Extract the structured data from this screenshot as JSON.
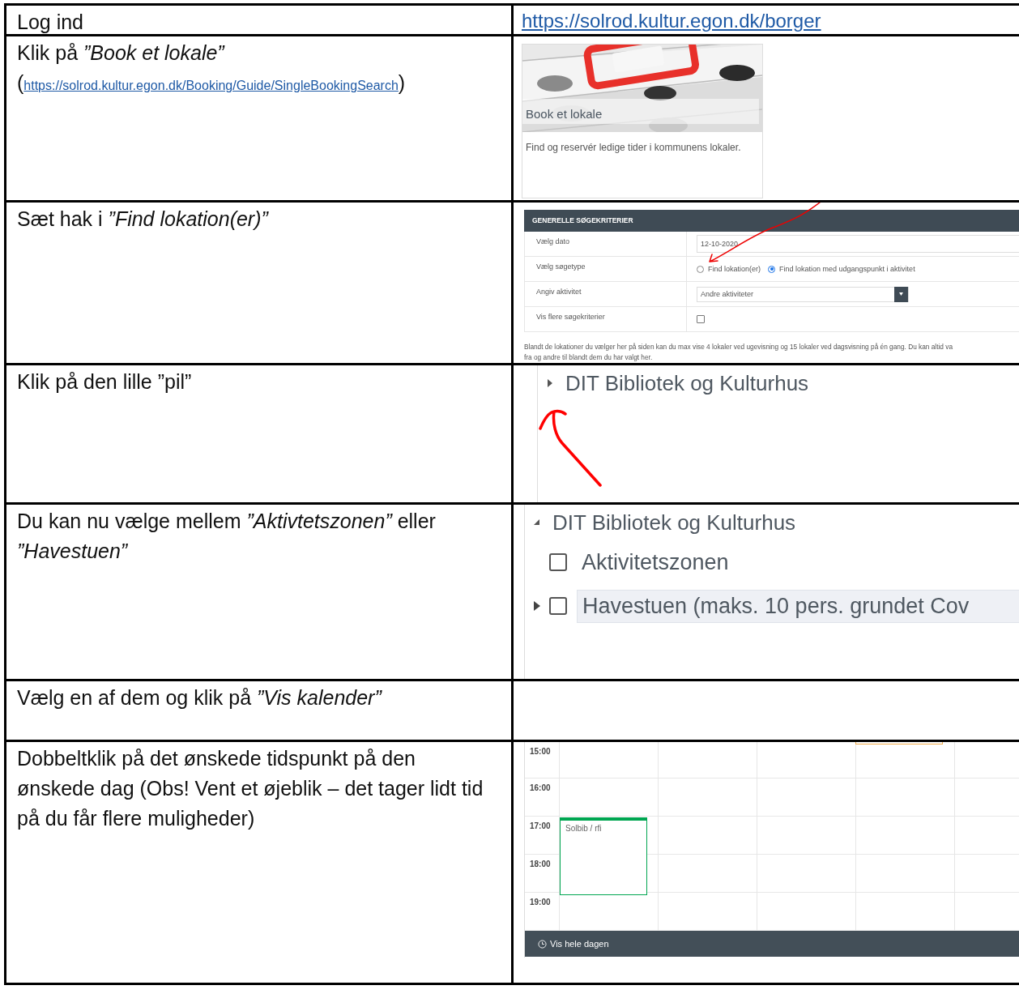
{
  "steps": [
    {
      "instruction": "Log ind",
      "illustration": {
        "kind": "link",
        "url": "https://solrod.kultur.egon.dk/borger"
      }
    },
    {
      "instruction": "Klik på *”Book et lokale”*",
      "link_prefix": "(",
      "link": "https://solrod.kultur.egon.dk/Booking/Guide/SingleBookingSearch",
      "link_suffix": ")",
      "illustration": {
        "kind": "card",
        "title": "Book et lokale",
        "description": "Find og reservér ledige tider i kommunens lokaler."
      }
    },
    {
      "instruction": "Sæt hak i *”Find lokation(er)”*",
      "illustration": {
        "kind": "form",
        "header": "GENERELLE SØGEKRITERIER",
        "fields": [
          {
            "kind": "date",
            "label": "Vælg dato",
            "value": "12-10-2020"
          },
          {
            "kind": "radio",
            "label": "Vælg søgetype",
            "options": [
              {
                "label": "Find lokation(er)",
                "selected": false
              },
              {
                "label": "Find lokation med udgangspunkt i aktivitet",
                "selected": true
              }
            ]
          },
          {
            "kind": "select",
            "label": "Angiv aktivitet",
            "value": "Andre aktiviteter"
          },
          {
            "kind": "checkbox",
            "label": "Vis flere søgekriterier",
            "checked": false
          }
        ],
        "note": [
          "Blandt de lokationer du vælger her på siden kan du max vise 4 lokaler ved ugevisning og 15 lokaler ved dagsvisning på én gang. Du kan altid va",
          "fra og andre til blandt dem du har valgt her."
        ]
      }
    },
    {
      "instruction": "Klik på den lille ”pil”",
      "illustration": {
        "kind": "tree",
        "arrow": true,
        "nodes": [
          {
            "label": "DIT Bibliotek og Kulturhus",
            "expanded": false
          }
        ]
      }
    },
    {
      "instruction": "Du kan nu vælge mellem *”Aktivtetszonen”* eller *”Havestuen”*",
      "illustration": {
        "kind": "tree",
        "arrow": false,
        "nodes": [
          {
            "label": "DIT Bibliotek og Kulturhus",
            "expanded": true,
            "children": [
              {
                "label": "Aktivitetszonen",
                "checked": false,
                "highlighted": false,
                "expandable": false
              },
              {
                "label": "Havestuen (maks. 10 pers. grundet Cov",
                "checked": false,
                "highlighted": true,
                "expandable": true
              }
            ]
          }
        ]
      }
    },
    {
      "instruction": "Vælg en af dem og klik på *”Vis kalender”*"
    },
    {
      "instruction": "Dobbeltklik på det ønskede tidspunkt på den ønskede dag (Obs! Vent et øjeblik – det tager lidt tid på du får flere muligheder)",
      "illustration": {
        "kind": "calendar",
        "times": [
          "15:00",
          "16:00",
          "17:00",
          "18:00",
          "19:00"
        ],
        "events": [
          {
            "kind": "tail",
            "color": "#f0ad4e"
          },
          {
            "kind": "block",
            "color": "#00a651",
            "label": "Solbib / rfi"
          }
        ],
        "footer": "Vis hele dagen"
      }
    }
  ]
}
